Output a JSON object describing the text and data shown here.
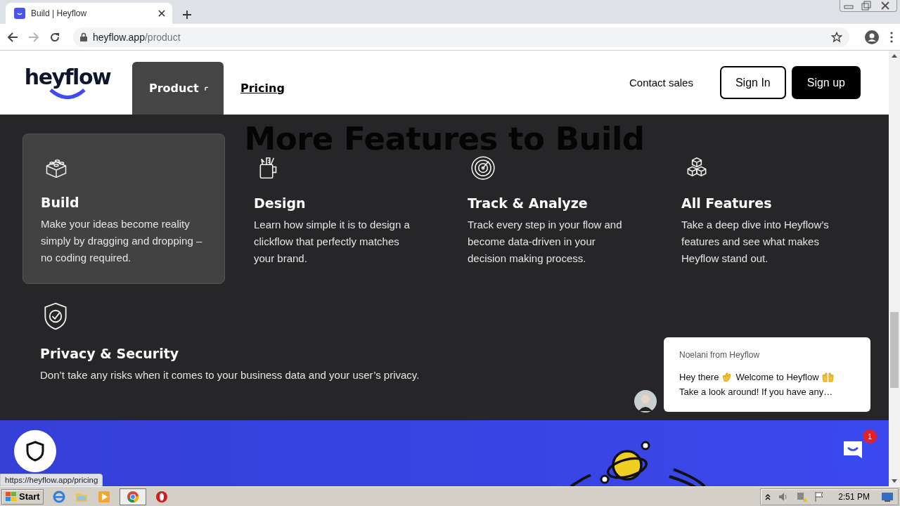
{
  "browser": {
    "tab_title": "Build | Heyflow",
    "url_host": "heyflow.app",
    "url_path": "/product",
    "forward_disabled": true
  },
  "nav": {
    "logo": "heyflow",
    "items": [
      {
        "label": "Product",
        "selected": true,
        "kind": "dropdown"
      },
      {
        "label": "Pricing",
        "selected": false,
        "kind": "link"
      }
    ],
    "contact": "Contact sales",
    "buttons": [
      {
        "label": "Sign In",
        "kind": "outline"
      },
      {
        "label": "Sign up",
        "kind": "solid"
      }
    ]
  },
  "section": {
    "heading": "More Features to Build"
  },
  "menu": {
    "items": [
      {
        "title": "Build",
        "text": "Make your ideas become reality simply by dragging and dropping – no coding required.",
        "kind": "bricks",
        "selected": true
      },
      {
        "title": "Design",
        "text": "Learn how simple it is to design a clickflow that perfectly matches your brand.",
        "kind": "mug",
        "selected": false
      },
      {
        "title": "Track & Analyze",
        "text": "Track every step in your flow and become data-driven in your decision making process.",
        "kind": "radar",
        "selected": false
      },
      {
        "title": "All Features",
        "text": "Take a deep dive into Heyflow’s features and see what makes Heyflow stand out.",
        "kind": "cubes",
        "selected": false
      },
      {
        "title": "Privacy & Security",
        "text": "Don’t take any risks when it comes to your business data and your user’s privacy.",
        "kind": "shield",
        "selected": false
      }
    ]
  },
  "chat": {
    "sender": "Noelani from Heyflow",
    "greeting": [
      "Hey there",
      "Welcome to Heyflow"
    ],
    "preview": "Take a look around! If you have any…",
    "badge": "1"
  },
  "status_url": "https://heyflow.app/pricing",
  "taskbar": {
    "start": "Start",
    "clock": "2:51 PM"
  }
}
